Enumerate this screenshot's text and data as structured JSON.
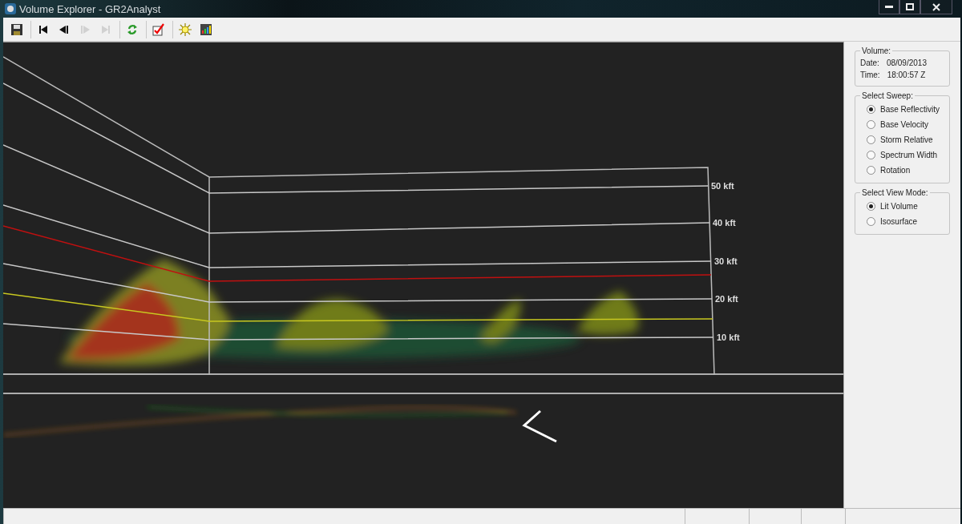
{
  "window": {
    "title": "Volume Explorer - GR2Analyst"
  },
  "toolbar": {
    "groups": [
      {
        "buttons": [
          {
            "kind": "save",
            "disabled": false
          }
        ]
      },
      {
        "buttons": [
          {
            "kind": "first",
            "disabled": false
          },
          {
            "kind": "prev",
            "disabled": false
          },
          {
            "kind": "next",
            "disabled": true
          },
          {
            "kind": "last",
            "disabled": true
          }
        ]
      },
      {
        "buttons": [
          {
            "kind": "refresh",
            "disabled": false
          }
        ]
      },
      {
        "buttons": [
          {
            "kind": "check",
            "disabled": false
          }
        ]
      },
      {
        "buttons": [
          {
            "kind": "light",
            "disabled": false
          },
          {
            "kind": "chart",
            "disabled": false
          }
        ]
      }
    ]
  },
  "viewport": {
    "altitude_labels": [
      "50 kft",
      "40 kft",
      "30 kft",
      "20 kft",
      "10 kft"
    ]
  },
  "volume": {
    "title": "Volume:",
    "fields": [
      {
        "label": "Date:",
        "value": "08/09/2013"
      },
      {
        "label": "Time:",
        "value": "18:00:57 Z"
      }
    ]
  },
  "sweep": {
    "title": "Select Sweep:",
    "options": [
      {
        "label": "Base Reflectivity",
        "selected": true
      },
      {
        "label": "Base Velocity",
        "selected": false
      },
      {
        "label": "Storm Relative",
        "selected": false
      },
      {
        "label": "Spectrum Width",
        "selected": false
      },
      {
        "label": "Rotation",
        "selected": false
      }
    ]
  },
  "view_mode": {
    "title": "Select View Mode:",
    "options": [
      {
        "label": "Lit Volume",
        "selected": true
      },
      {
        "label": "Isosurface",
        "selected": false
      }
    ]
  }
}
